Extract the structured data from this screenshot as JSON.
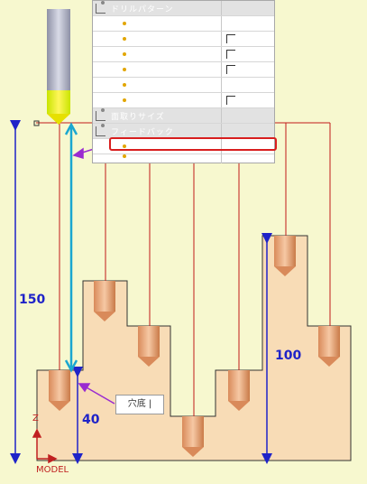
{
  "panel": {
    "group1_label": "ドリルパターン",
    "group2_label": "面取りサイズ",
    "group3_label": "フィードバック",
    "rows_group1": [
      {
        "checkbox": false
      },
      {
        "checkbox": true
      },
      {
        "checkbox": true
      },
      {
        "checkbox": true
      },
      {
        "checkbox": false
      },
      {
        "checkbox": true
      }
    ],
    "rows_group3": [
      {
        "highlighted": false
      },
      {
        "highlighted": true
      },
      {
        "highlighted": false
      }
    ]
  },
  "dimensions": {
    "left_height": "150",
    "right_height": "100",
    "bottom_height": "40"
  },
  "callout": {
    "label": "穴底 |"
  },
  "axis": {
    "z_label": "Z",
    "model_label": "MODEL"
  },
  "colors": {
    "background": "#f7f8cf",
    "part_fill": "#f8dcb6",
    "dimension_line": "#1f23c8",
    "reference_line": "#c01a1a",
    "arrow_purple": "#9a2bd0",
    "tool_yellow": "#f3ef2a"
  }
}
